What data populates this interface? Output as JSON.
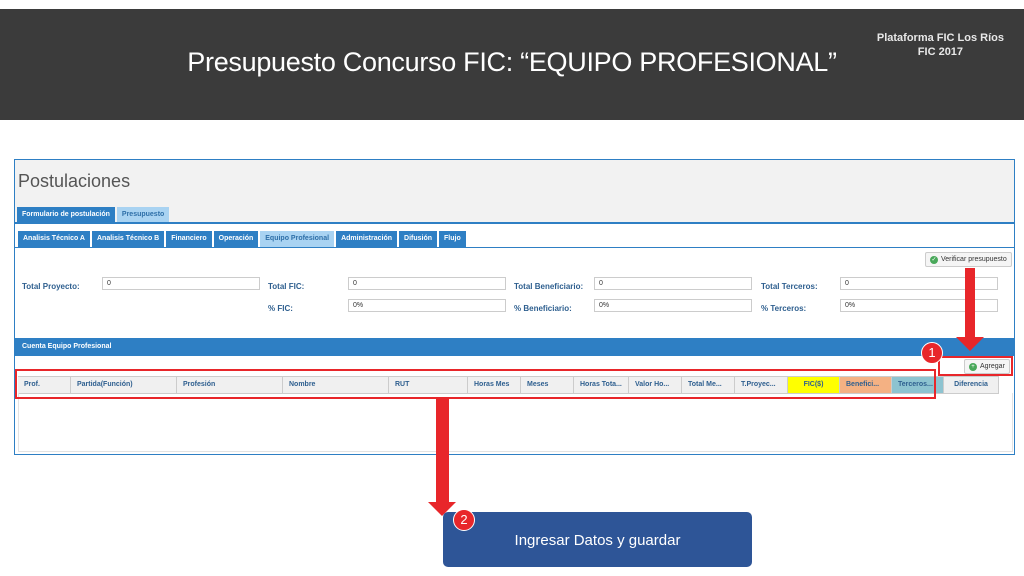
{
  "header": {
    "title": "Presupuesto Concurso FIC: “EQUIPO PROFESIONAL”",
    "brand_line1": "Plataforma FIC Los Ríos",
    "brand_line2": "FIC 2017"
  },
  "panel": {
    "title": "Postulaciones",
    "tabs_primary": [
      "Formulario de postulación",
      "Presupuesto"
    ],
    "tabs_secondary": [
      "Analisis Técnico A",
      "Analisis Técnico B",
      "Financiero",
      "Operación",
      "Equipo Profesional",
      "Administración",
      "Difusión",
      "Flujo"
    ],
    "verify_label": "Verificar presupuesto",
    "totals": {
      "total_proyecto_label": "Total Proyecto:",
      "total_proyecto_value": "0",
      "total_fic_label": "Total FIC:",
      "total_fic_value": "0",
      "pct_fic_label": "% FIC:",
      "pct_fic_value": "0%",
      "total_benef_label": "Total Beneficiario:",
      "total_benef_value": "0",
      "pct_benef_label": "% Beneficiario:",
      "pct_benef_value": "0%",
      "total_terceros_label": "Total Terceros:",
      "total_terceros_value": "0",
      "pct_terceros_label": "% Terceros:",
      "pct_terceros_value": "0%"
    },
    "section_title": "Cuenta Equipo Profesional",
    "add_label": "Agregar",
    "columns": [
      "Prof.",
      "Partida(Función)",
      "Profesión",
      "Nombre",
      "RUT",
      "Horas Mes",
      "Meses",
      "Horas Tota...",
      "Valor Ho...",
      "Total Me...",
      "T.Proyec...",
      "FIC($)",
      "Benefici...",
      "Terceros...",
      "Diferencia"
    ]
  },
  "annotations": {
    "badge1": "1",
    "badge2": "2",
    "callout": "Ingresar Datos y guardar"
  },
  "colors": {
    "header_bg": "#3b3b3b",
    "primary_blue": "#2e7fc4",
    "highlight_red": "#e8262a",
    "fic_yellow": "#ffff00",
    "benef_orange": "#f4b183",
    "terceros_teal": "#8dc3d0",
    "callout_blue": "#2e5597"
  }
}
